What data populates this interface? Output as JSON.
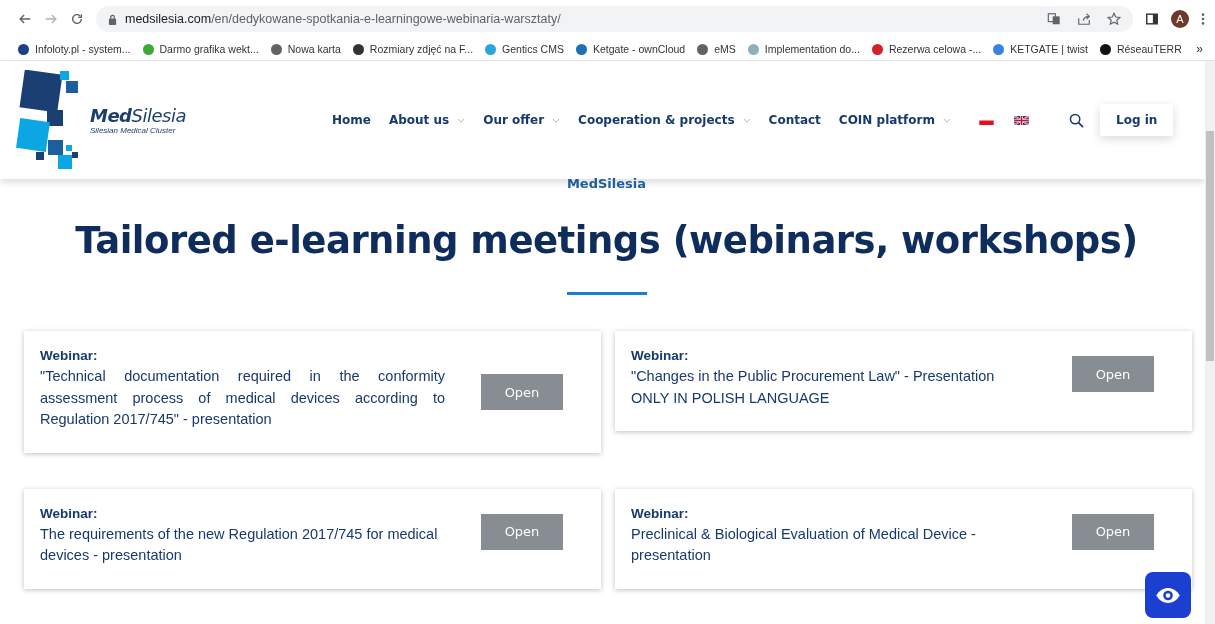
{
  "browser": {
    "url": {
      "host": "medsilesia.com",
      "path": "/en/dedykowane-spotkania-e-learningowe-webinaria-warsztaty/"
    },
    "profile": "A",
    "bookmarks": [
      {
        "label": "Infoloty.pl - system...",
        "color": "#1e3f8a"
      },
      {
        "label": "Darmo grafika wekt...",
        "color": "#3aaa35"
      },
      {
        "label": "Nowa karta",
        "color": "#5f6368"
      },
      {
        "label": "Rozmiary zdjęć na F...",
        "color": "#333333"
      },
      {
        "label": "Gentics CMS",
        "color": "#2aa4e0"
      },
      {
        "label": "Ketgate - ownCloud",
        "color": "#1d6fb8"
      },
      {
        "label": "eMS",
        "color": "#5f6368"
      },
      {
        "label": "Implementation do...",
        "color": "#8fb0b8"
      },
      {
        "label": "Rezerwa celowa -...",
        "color": "#d42027"
      },
      {
        "label": "KETGATE | twist",
        "color": "#3b82e6"
      },
      {
        "label": "RéseauTERR",
        "color": "#111111"
      }
    ],
    "overflow": "»"
  },
  "site": {
    "logo": {
      "name_bold": "Med",
      "name_rest": "Silesia",
      "tagline": "Silesian Medical Cluster"
    },
    "nav": [
      {
        "label": "Home",
        "dropdown": false
      },
      {
        "label": "About us",
        "dropdown": true
      },
      {
        "label": "Our offer",
        "dropdown": true
      },
      {
        "label": "Cooperation & projects",
        "dropdown": true
      },
      {
        "label": "Contact",
        "dropdown": false
      },
      {
        "label": "COIN platform",
        "dropdown": true
      }
    ],
    "login": "Log in",
    "overline": "MedSilesia",
    "title": "Tailored e-learning meetings (webinars, workshops)",
    "cards": [
      {
        "label": "Webinar:",
        "text": "\"Technical documentation required in the conformity assessment process of medical devices according to Regulation 2017/745\" - presentation",
        "button": "Open",
        "justified": true
      },
      {
        "label": "Webinar:",
        "text": "\"Changes in the Public Procurement Law\" - Presentation ONLY IN POLISH LANGUAGE",
        "button": "Open",
        "justified": false
      },
      {
        "label": "Webinar:",
        "text": "The requirements of the new Regulation 2017/745 for medical devices - presentation",
        "button": "Open",
        "justified": false
      },
      {
        "label": "Webinar:",
        "text": "Preclinical & Biological Evaluation of Medical Device - presentation",
        "button": "Open",
        "justified": false
      }
    ]
  }
}
